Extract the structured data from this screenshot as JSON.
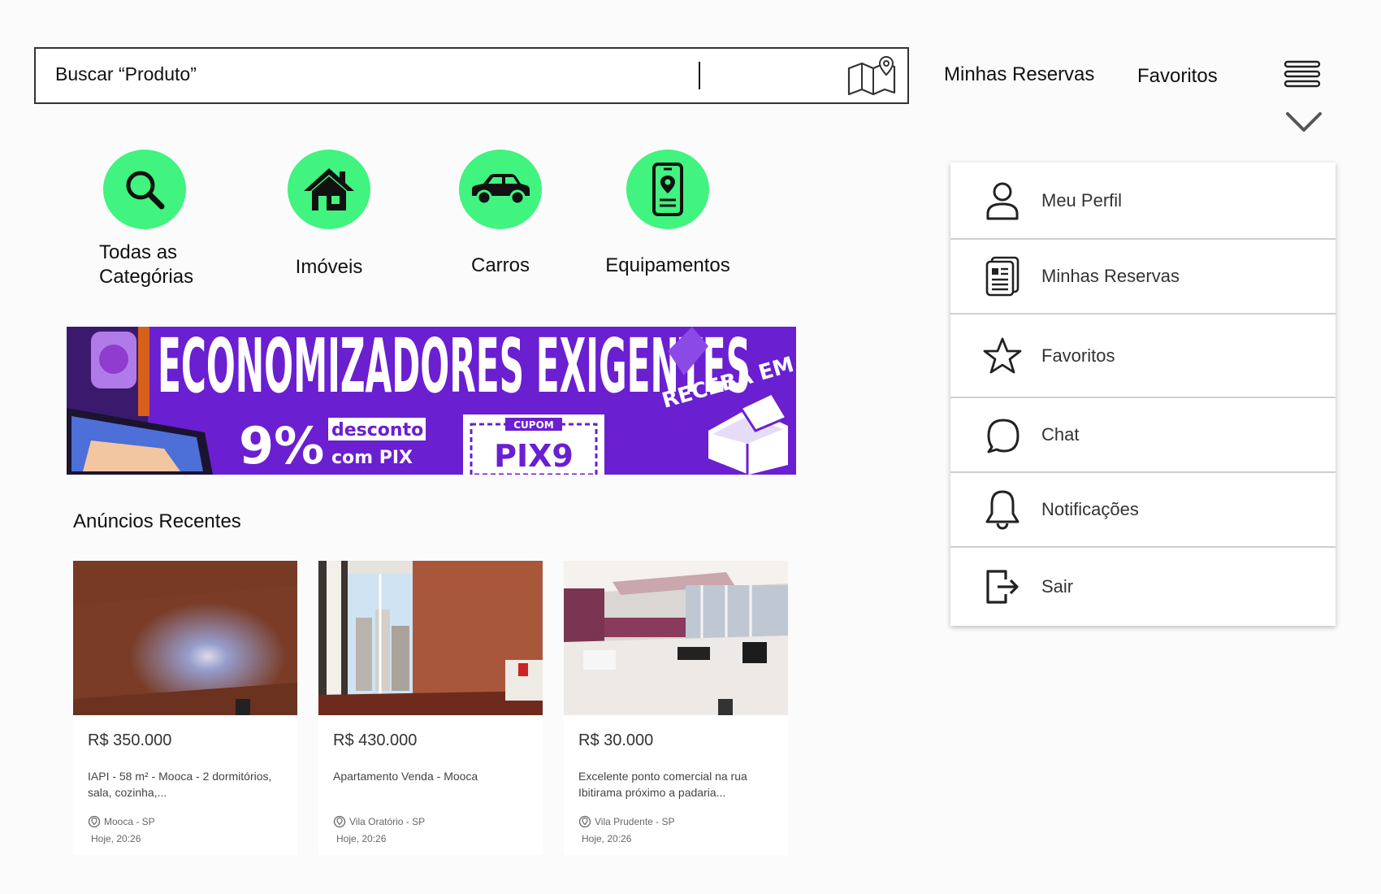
{
  "search": {
    "placeholder_text": "Buscar “Produto”"
  },
  "header": {
    "link_reservas": "Minhas Reservas",
    "link_favoritos": "Favoritos"
  },
  "categories": [
    {
      "label": "Todas as Categórias",
      "icon": "search-icon"
    },
    {
      "label": "Imóveis",
      "icon": "house-icon"
    },
    {
      "label": "Carros",
      "icon": "car-icon"
    },
    {
      "label": "Equipamentos",
      "icon": "phone-location-icon"
    }
  ],
  "banner": {
    "headline": "ECONOMIZADORES EXIGENTES",
    "discount": "9%",
    "discount_word": "desconto",
    "discount_method": "com PIX",
    "coupon_label": "CUPOM",
    "coupon_code": "PIX9",
    "delivery": "RECEBA EM CASA"
  },
  "recent": {
    "title": "Anúncios Recentes",
    "listings": [
      {
        "price": "R$ 350.000",
        "description": "IAPI - 58 m² - Mooca - 2 dormitórios, sala, cozinha,...",
        "location": "Mooca - SP",
        "time": "Hoje, 20:26"
      },
      {
        "price": "R$ 430.000",
        "description": "Apartamento Venda - Mooca",
        "location": "Vila Oratório - SP",
        "time": "Hoje, 20:26"
      },
      {
        "price": "R$ 30.000",
        "description": "Excelente ponto comercial na rua Ibitirama próximo a padaria...",
        "location": "Vila Prudente - SP",
        "time": "Hoje, 20:26"
      }
    ]
  },
  "menu": {
    "items": [
      {
        "label": "Meu Perfil",
        "icon": "user-icon"
      },
      {
        "label": "Minhas Reservas",
        "icon": "document-icon"
      },
      {
        "label": "Favoritos",
        "icon": "star-icon"
      },
      {
        "label": "Chat",
        "icon": "chat-icon"
      },
      {
        "label": "Notificações",
        "icon": "bell-icon"
      },
      {
        "label": "Sair",
        "icon": "logout-icon"
      }
    ]
  },
  "colors": {
    "accent": "#41f37f",
    "banner_purple": "#6a1fd1"
  }
}
